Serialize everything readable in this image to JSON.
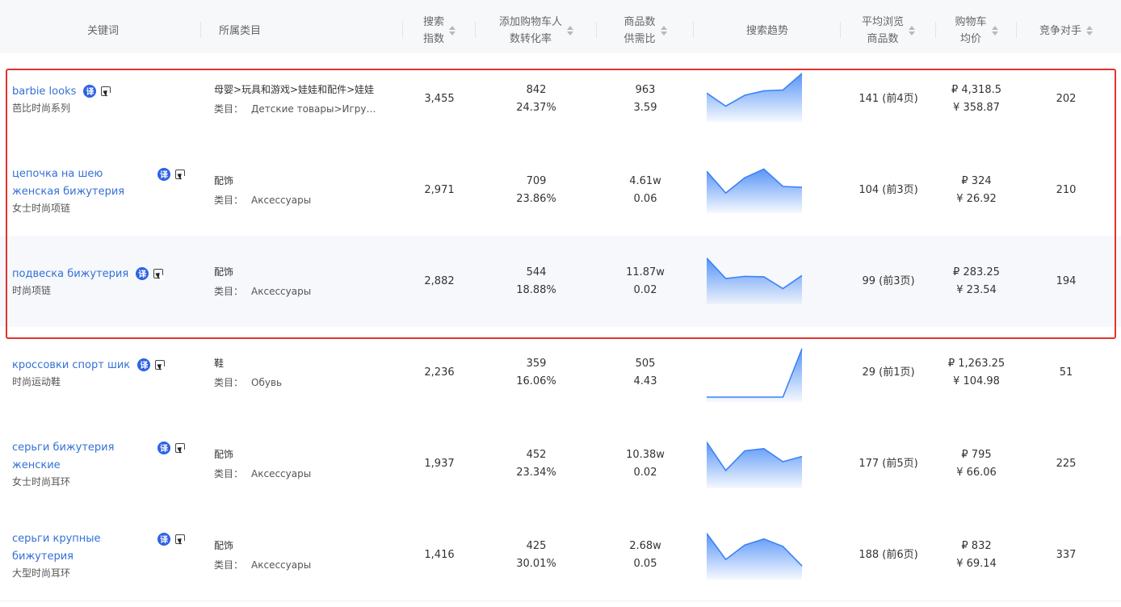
{
  "header": {
    "keyword": "关键词",
    "category": "所属类目",
    "search_index": [
      "搜索",
      "指数"
    ],
    "cart_rate": [
      "添加购物车人",
      "数转化率"
    ],
    "supply_ratio": [
      "商品数",
      "供需比"
    ],
    "trend": "搜索趋势",
    "avg_browse": [
      "平均浏览",
      "商品数"
    ],
    "cart_price": [
      "购物车",
      "均价"
    ],
    "competitors": "竞争对手"
  },
  "translate_badge": "译",
  "rows": [
    {
      "keyword": "barbie looks",
      "keyword_sub": "芭比时尚系列",
      "category": "母婴>玩具和游戏>娃娃和配件>娃娃",
      "category_label": "类目：",
      "category_ru": "Детские товары>Игрушки ...",
      "search_index": "3,455",
      "cart_people": "842",
      "cart_rate": "24.37%",
      "goods": "963",
      "supply": "3.59",
      "trend": [
        0.55,
        0.25,
        0.5,
        0.6,
        0.62,
        1.0
      ],
      "avg_browse": "141 (前4页)",
      "price_rub": "₽ 4,318.5",
      "price_cny": "¥ 358.87",
      "competitors": "202"
    },
    {
      "keyword": "цепочка на шею женская бижутерия",
      "keyword_sub": "女士时尚项链",
      "category": "配饰",
      "category_label": "类目：",
      "category_ru": "Аксессуары",
      "search_index": "2,971",
      "cart_people": "709",
      "cart_rate": "23.86%",
      "goods": "4.61w",
      "supply": "0.06",
      "trend": [
        0.85,
        0.35,
        0.7,
        0.9,
        0.5,
        0.48
      ],
      "avg_browse": "104 (前3页)",
      "price_rub": "₽ 324",
      "price_cny": "¥ 26.92",
      "competitors": "210"
    },
    {
      "keyword": "подвеска бижутерия",
      "keyword_sub": "时尚项链",
      "category": "配饰",
      "category_label": "类目：",
      "category_ru": "Аксессуары",
      "search_index": "2,882",
      "cart_people": "544",
      "cart_rate": "18.88%",
      "goods": "11.87w",
      "supply": "0.02",
      "trend": [
        0.95,
        0.48,
        0.53,
        0.52,
        0.25,
        0.55
      ],
      "avg_browse": "99 (前3页)",
      "price_rub": "₽ 283.25",
      "price_cny": "¥ 23.54",
      "competitors": "194"
    },
    {
      "keyword": "кроссовки спорт шик",
      "keyword_sub": "时尚运动鞋",
      "category": "鞋",
      "category_label": "类目：",
      "category_ru": "Обувь",
      "search_index": "2,236",
      "cart_people": "359",
      "cart_rate": "16.06%",
      "goods": "505",
      "supply": "4.43",
      "trend": [
        0.0,
        0.0,
        0.0,
        0.0,
        0.0,
        1.0
      ],
      "avg_browse": "29 (前1页)",
      "price_rub": "₽ 1,263.25",
      "price_cny": "¥ 104.98",
      "competitors": "51"
    },
    {
      "keyword": "серьги бижутерия женские",
      "keyword_sub": "女士时尚耳环",
      "category": "配饰",
      "category_label": "类目：",
      "category_ru": "Аксессуары",
      "search_index": "1,937",
      "cart_people": "452",
      "cart_rate": "23.34%",
      "goods": "10.38w",
      "supply": "0.02",
      "trend": [
        0.95,
        0.3,
        0.75,
        0.8,
        0.5,
        0.62
      ],
      "avg_browse": "177 (前5页)",
      "price_rub": "₽ 795",
      "price_cny": "¥ 66.06",
      "competitors": "225"
    },
    {
      "keyword": "серьги крупные бижутерия",
      "keyword_sub": "大型时尚耳环",
      "category": "配饰",
      "category_label": "类目：",
      "category_ru": "Аксессуары",
      "search_index": "1,416",
      "cart_people": "425",
      "cart_rate": "30.01%",
      "goods": "2.68w",
      "supply": "0.05",
      "trend": [
        0.95,
        0.35,
        0.68,
        0.82,
        0.65,
        0.2
      ],
      "avg_browse": "188 (前6页)",
      "price_rub": "₽ 832",
      "price_cny": "¥ 69.14",
      "competitors": "337"
    }
  ],
  "colors": {
    "accent": "#3470d6",
    "trend_line": "#3b82f6",
    "highlight": "#e5322d",
    "badge": "#2d62e6"
  }
}
